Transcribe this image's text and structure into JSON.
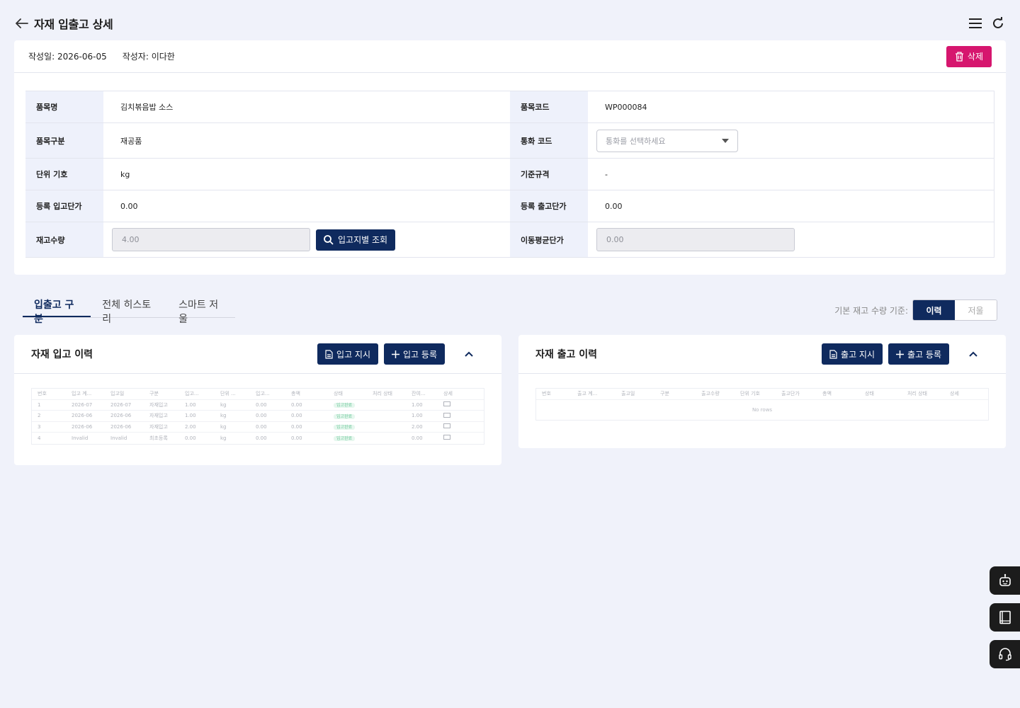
{
  "header": {
    "title": "자재 입출고 상세",
    "back_icon": "arrow-left-icon",
    "menu_icon": "menu-icon",
    "refresh_icon": "refresh-icon"
  },
  "meta": {
    "created_date": "작성일: 2026-06-05",
    "author": "작성자: 이다한",
    "delete_label": "삭제"
  },
  "info": {
    "item_name_label": "품목명",
    "item_name": "김치볶음밥 소스",
    "item_code_label": "품목코드",
    "item_code": "WP000084",
    "item_type_label": "품목구분",
    "item_type": "재공품",
    "currency_label": "통화 코드",
    "currency_placeholder": "통화를 선택하세요",
    "unit_label": "단위 기호",
    "unit": "kg",
    "standard_label": "기준규격",
    "standard": "-",
    "in_price_label": "등록 입고단가",
    "in_price": "0.00",
    "out_price_label": "등록 출고단가",
    "out_price": "0.00",
    "stock_label": "재고수량",
    "stock": "4.00",
    "lookup_label": "입고지별 조회",
    "avg_price_label": "이동평균단가",
    "avg_price": "0.00"
  },
  "tabs": [
    "입출고 구분",
    "전체 히스토리",
    "스마트 저울"
  ],
  "basis": {
    "label": "기본 재고 수량 기준:",
    "options": [
      "이력",
      "저울"
    ]
  },
  "in_panel": {
    "title": "자재 입고 이력",
    "instruct_label": "입고 지시",
    "register_label": "입고 등록",
    "columns": [
      "번호",
      "입고 계...",
      "입고일",
      "구분",
      "입고...",
      "단위 ...",
      "입고...",
      "총액",
      "상태",
      "처리 상태",
      "잔여...",
      "상세"
    ],
    "rows": [
      [
        "1",
        "2026-07",
        "2026-07",
        "자재입고",
        "1.00",
        "kg",
        "0.00",
        "0.00",
        "입고완료",
        "",
        "1.00",
        ""
      ],
      [
        "2",
        "2026-06",
        "2026-06",
        "자재입고",
        "1.00",
        "kg",
        "0.00",
        "0.00",
        "입고완료",
        "",
        "1.00",
        ""
      ],
      [
        "3",
        "2026-06",
        "2026-06",
        "자재입고",
        "2.00",
        "kg",
        "0.00",
        "0.00",
        "입고완료",
        "",
        "2.00",
        ""
      ],
      [
        "4",
        "Invalid",
        "Invalid",
        "최초등록",
        "0.00",
        "kg",
        "0.00",
        "0.00",
        "입고완료",
        "",
        "0.00",
        ""
      ]
    ]
  },
  "out_panel": {
    "title": "자재 출고 이력",
    "instruct_label": "출고 지시",
    "register_label": "출고 등록",
    "columns": [
      "번호",
      "출고 계...",
      "출고일",
      "구분",
      "출고수량",
      "단위 기호",
      "출고단가",
      "총액",
      "상태",
      "처리 상태",
      "상세"
    ],
    "empty": "No rows"
  },
  "fabs": [
    "robot-icon",
    "book-icon",
    "headset-icon"
  ],
  "colors": {
    "navy": "#0f2a5e",
    "delete": "#d6166e",
    "background": "#f0f2fa"
  }
}
